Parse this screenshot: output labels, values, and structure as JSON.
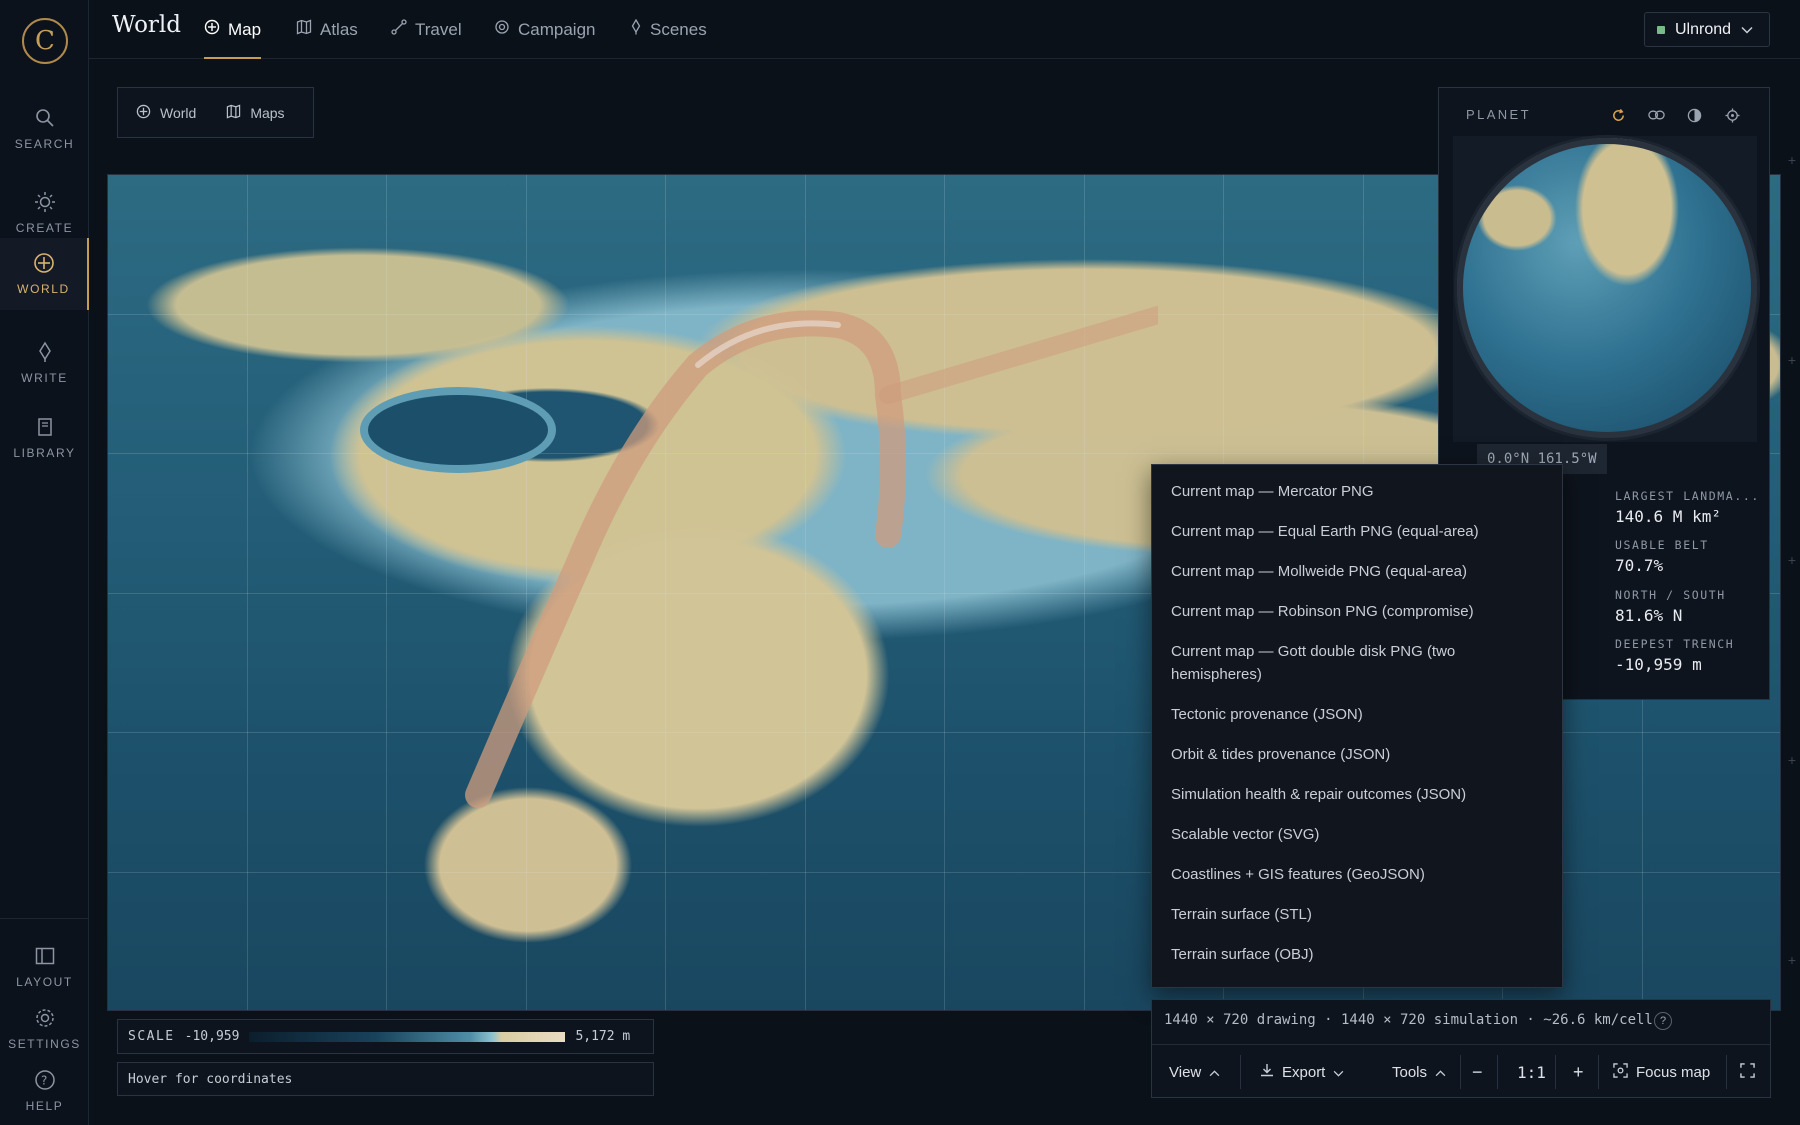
{
  "app": {
    "logo_glyph": "C",
    "title": "World"
  },
  "nav": {
    "tabs": [
      {
        "label": "Map",
        "icon": "globe-plus-icon",
        "active": true
      },
      {
        "label": "Atlas",
        "icon": "book-map-icon"
      },
      {
        "label": "Travel",
        "icon": "route-icon"
      },
      {
        "label": "Campaign",
        "icon": "target-icon"
      },
      {
        "label": "Scenes",
        "icon": "quill-icon"
      }
    ],
    "user": "Ulnrond"
  },
  "rail": {
    "top": [
      {
        "label": "SEARCH",
        "icon": "search-icon"
      },
      {
        "label": "CREATE",
        "icon": "sun-icon"
      },
      {
        "label": "WORLD",
        "icon": "globe-icon",
        "active": true
      },
      {
        "label": "WRITE",
        "icon": "quill-icon"
      },
      {
        "label": "LIBRARY",
        "icon": "book-icon"
      }
    ],
    "bottom": [
      {
        "label": "LAYOUT",
        "icon": "layout-icon"
      },
      {
        "label": "SETTINGS",
        "icon": "gear-icon"
      },
      {
        "label": "HELP",
        "icon": "help-icon"
      }
    ]
  },
  "subtabs": [
    {
      "label": "World",
      "icon": "globe-plus-icon"
    },
    {
      "label": "Maps",
      "icon": "map-icon"
    }
  ],
  "planet": {
    "title": "PLANET",
    "coords": "0.0°N 161.5°W",
    "stats": [
      {
        "label": "LARGEST LANDMA...",
        "value": "140.6 M km²"
      },
      {
        "label": "USABLE BELT",
        "value": "70.7%"
      },
      {
        "label": "NORTH / SOUTH",
        "value": "81.6% N"
      },
      {
        "label": "DEEPEST TRENCH",
        "value": "-10,959 m"
      }
    ]
  },
  "export_menu": {
    "items": [
      "Current map — Mercator PNG",
      "Current map — Equal Earth PNG (equal-area)",
      "Current map — Mollweide PNG (equal-area)",
      "Current map — Robinson PNG (compromise)",
      "Current map — Gott double disk PNG (two hemispheres)",
      "Tectonic provenance (JSON)",
      "Orbit & tides provenance (JSON)",
      "Simulation health & repair outcomes (JSON)",
      "Scalable vector (SVG)",
      "Coastlines + GIS features (GeoJSON)",
      "Terrain surface (STL)",
      "Terrain surface (OBJ)"
    ]
  },
  "status": {
    "text": "1440 × 720 drawing · 1440 × 720 simulation · ~26.6 km/cell",
    "help": "?"
  },
  "toolbar": {
    "view": "View",
    "export": "Export",
    "tools": "Tools",
    "zoom_out": "−",
    "zoom": "1:1",
    "zoom_in": "+",
    "focus": "Focus map"
  },
  "scale": {
    "label": "SCALE",
    "min": "-10,959",
    "max": "5,172 m"
  },
  "coords_hint": "Hover for coordinates",
  "colors": {
    "accent": "#c89c53",
    "background": "#0b1119",
    "ocean": "#235d77",
    "land": "#cfc293"
  }
}
